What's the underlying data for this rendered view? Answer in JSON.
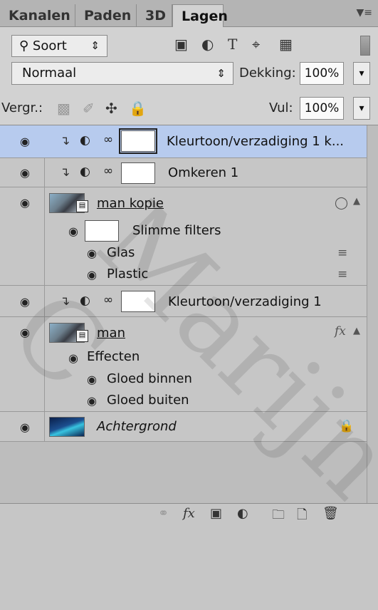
{
  "tabs": [
    "Kanalen",
    "Paden",
    "3D",
    "Lagen"
  ],
  "active_tab": "Lagen",
  "panel_menu_icon": "panel-menu-icon",
  "filter": {
    "kind_label": "Soort",
    "search_icon": "search-icon",
    "filter_icons": [
      "pixel-filter-icon",
      "adjustment-filter-icon",
      "type-filter-icon",
      "shape-filter-icon",
      "smart-object-filter-icon"
    ]
  },
  "blend": {
    "mode": "Normaal",
    "opacity_label": "Dekking:",
    "opacity_value": "100%",
    "lock_label": "Vergr.:",
    "fill_label": "Vul:",
    "fill_value": "100%"
  },
  "layers": [
    {
      "name": "Kleurtoon/verzadiging 1 k...",
      "type": "adjustment",
      "selected": true
    },
    {
      "name": "Omkeren 1",
      "type": "adjustment",
      "selected": false
    },
    {
      "name": "man kopie",
      "type": "smart-object",
      "selected": false,
      "smart_filters_label": "Slimme filters",
      "filters": [
        "Glas",
        "Plastic"
      ]
    },
    {
      "name": "Kleurtoon/verzadiging 1",
      "type": "adjustment",
      "selected": false
    },
    {
      "name": "man",
      "type": "smart-object",
      "selected": false,
      "effects_label": "Effecten",
      "effects": [
        "Gloed binnen",
        "Gloed buiten"
      ]
    },
    {
      "name": "Achtergrond",
      "type": "background",
      "selected": false
    }
  ],
  "watermark": "Marijn C",
  "bottom_icons": [
    "link-layers-icon",
    "fx-icon",
    "add-mask-icon",
    "adjustment-layer-icon",
    "group-icon",
    "new-layer-icon",
    "delete-icon"
  ]
}
